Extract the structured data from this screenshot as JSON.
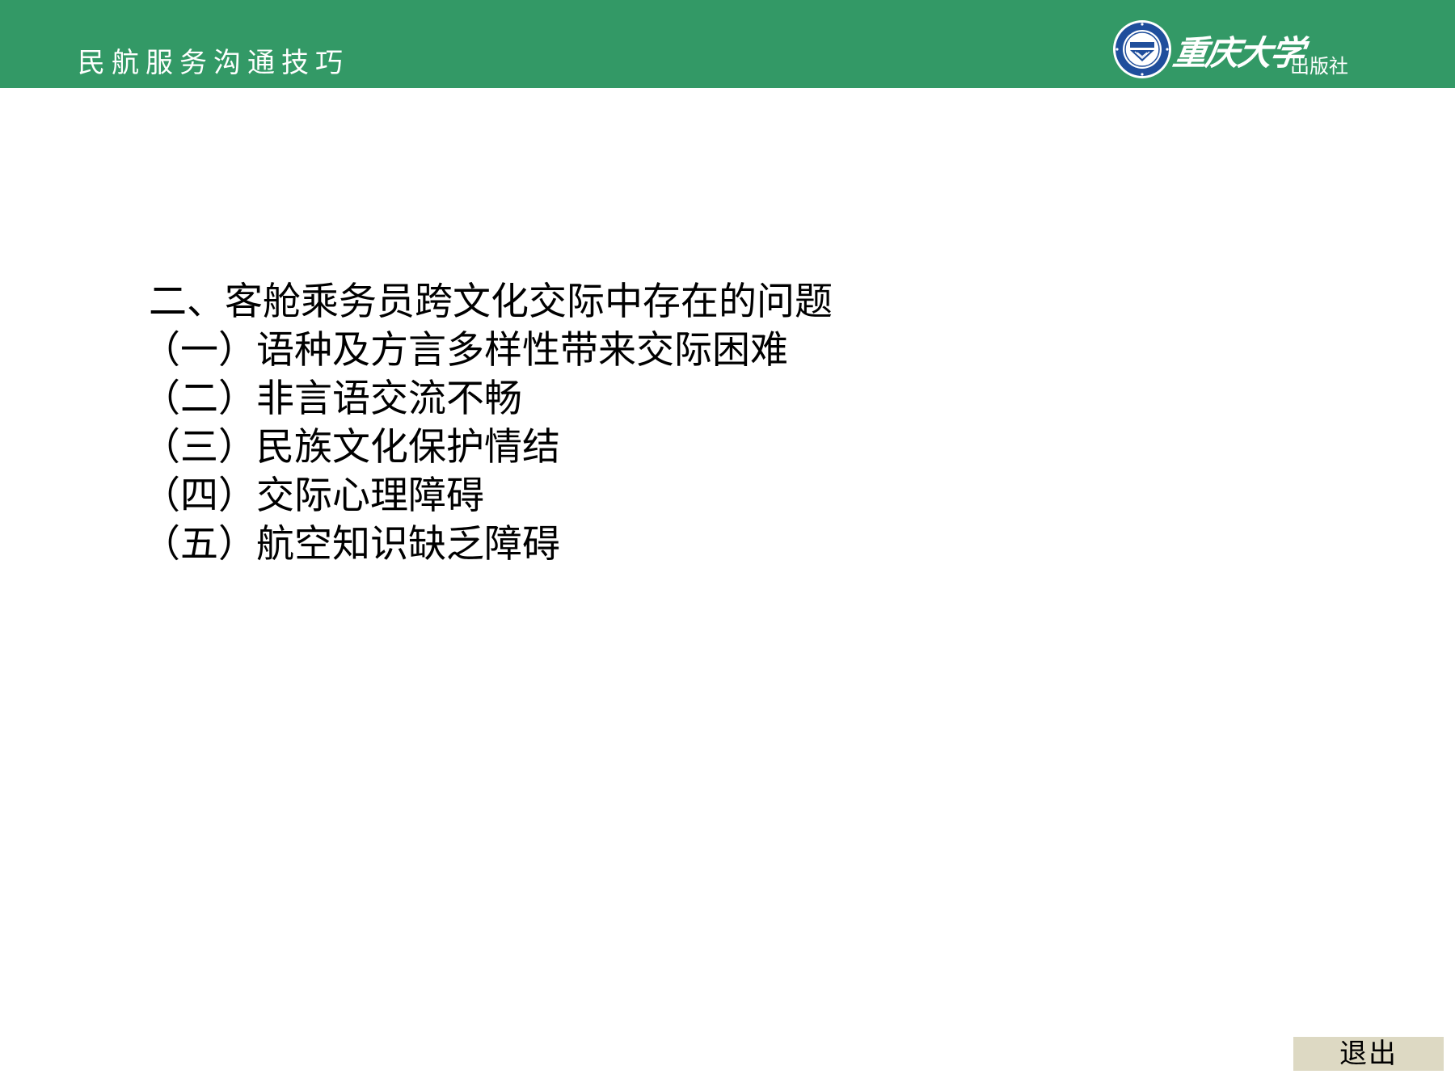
{
  "header": {
    "course_title": "民航服务沟通技巧",
    "background_color": "#339966",
    "publisher": {
      "emblem_icon": "chongqing-university-emblem-icon",
      "university_name": "重庆大学",
      "suffix": "出版社"
    }
  },
  "content": {
    "heading": "二、客舱乘务员跨文化交际中存在的问题",
    "items": [
      "（一）语种及方言多样性带来交际困难",
      "（二）非言语交流不畅",
      "（三）民族文化保护情结",
      "（四）交际心理障碍",
      "（五）航空知识缺乏障碍"
    ]
  },
  "footer": {
    "exit_label": "退出",
    "exit_color": "#ddd9c3"
  }
}
